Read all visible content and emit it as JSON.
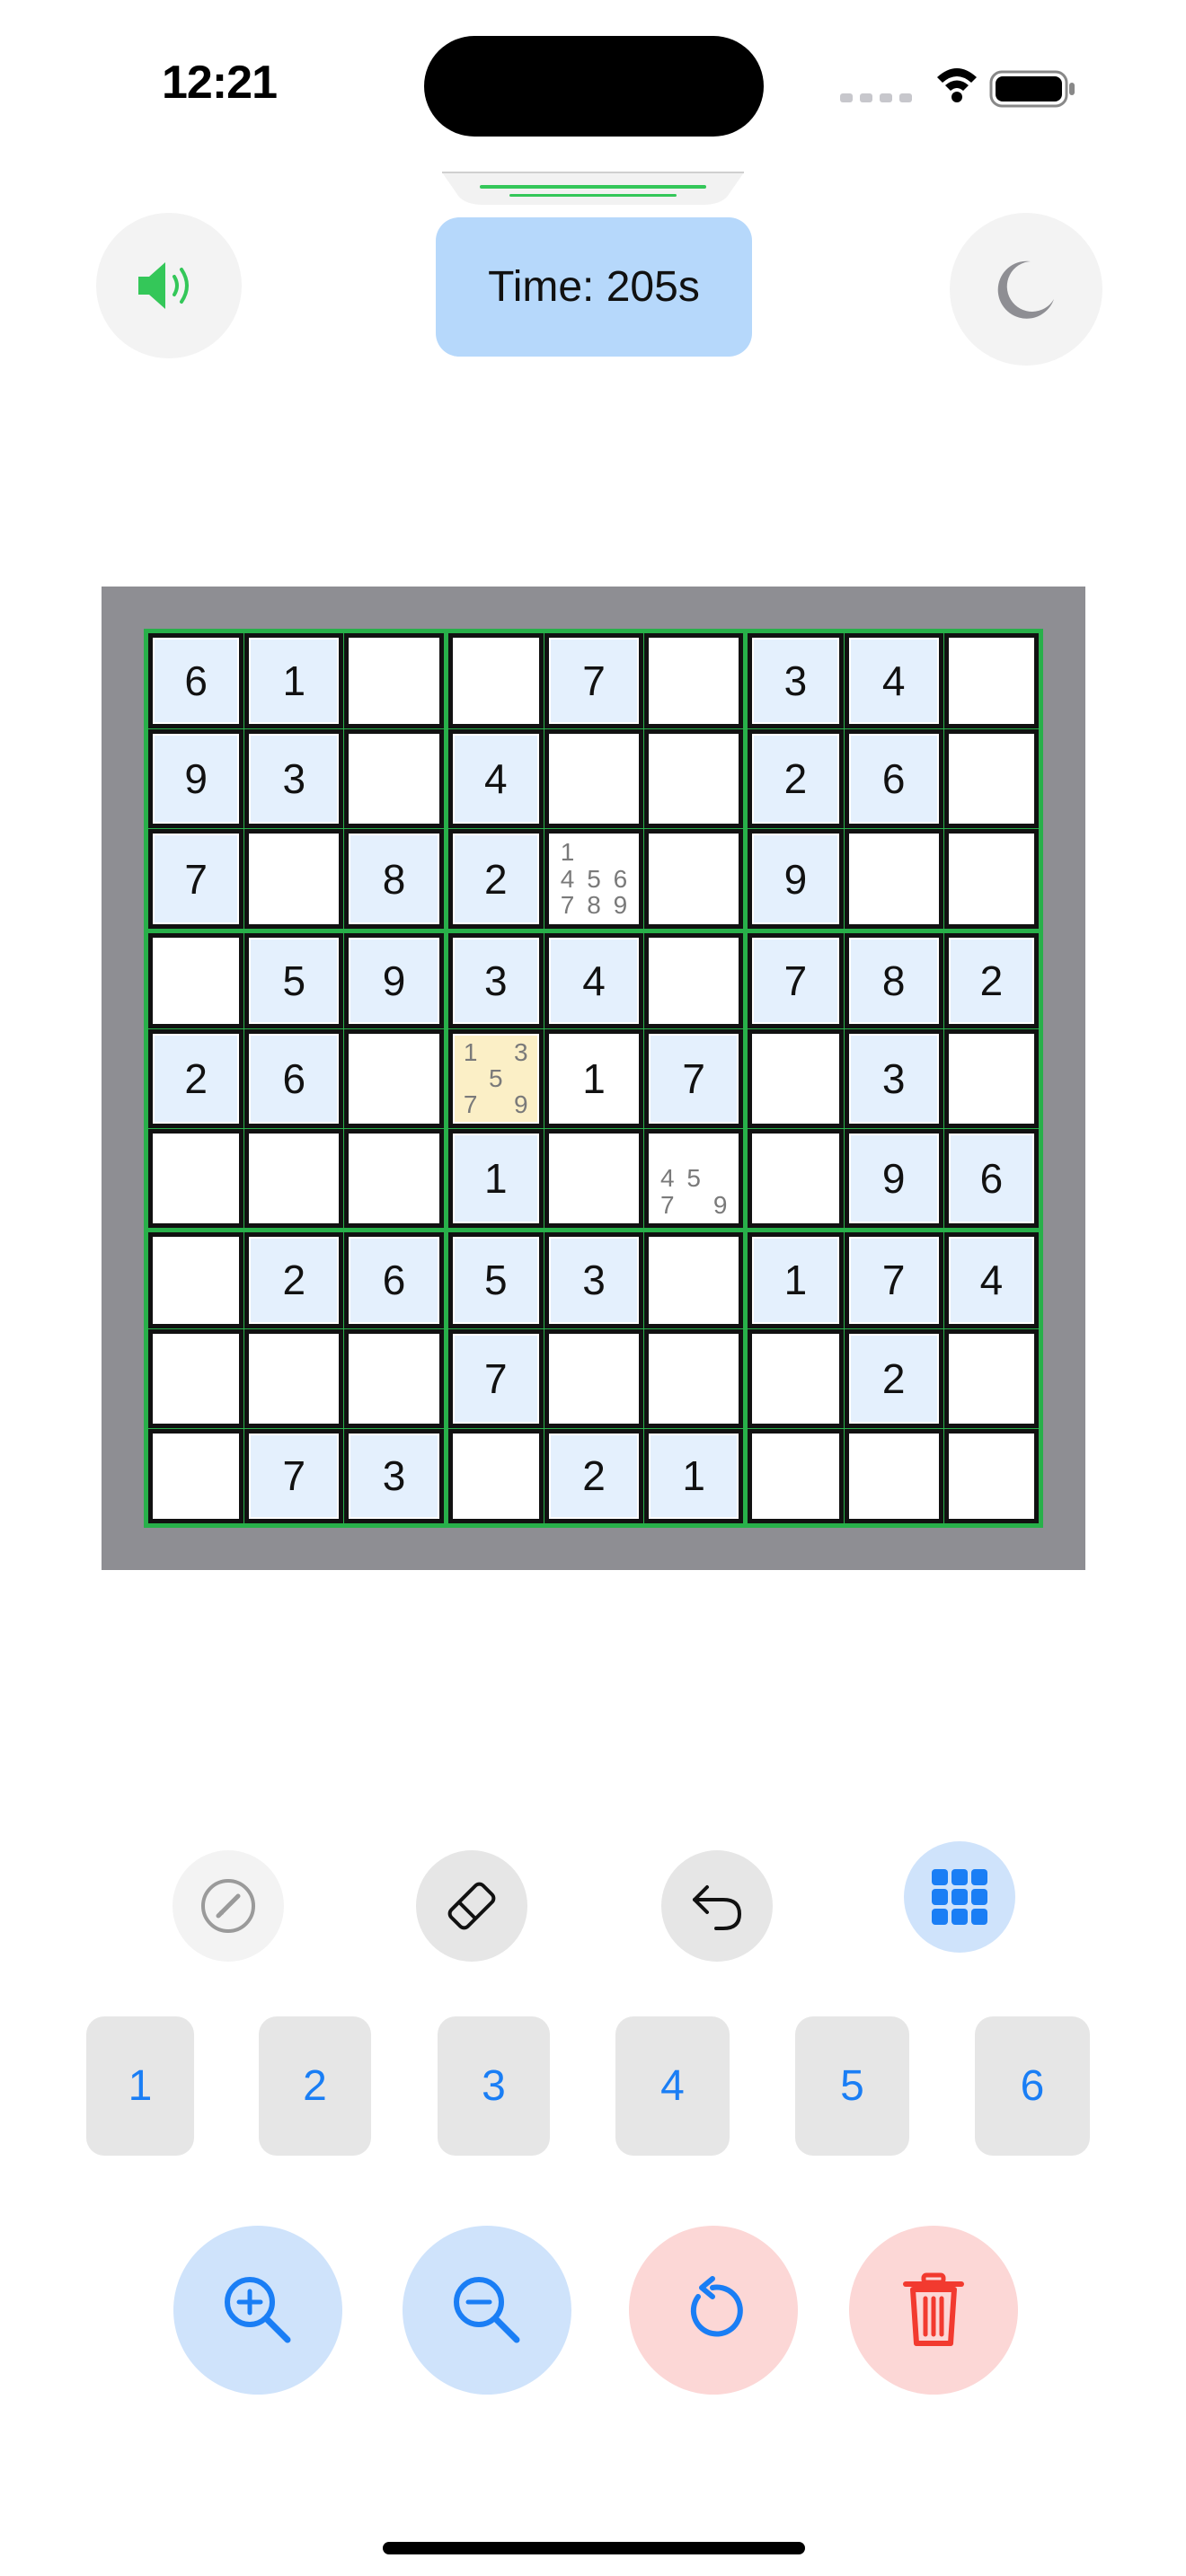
{
  "status_bar": {
    "time": "12:21"
  },
  "header": {
    "timer_text": "Time: 205s",
    "sound_icon": "speaker-wave-icon",
    "theme_icon": "moon-icon"
  },
  "board": {
    "rows": [
      [
        {
          "v": "6",
          "g": true
        },
        {
          "v": "1",
          "g": true
        },
        {
          "v": ""
        },
        {
          "v": ""
        },
        {
          "v": "7",
          "g": true
        },
        {
          "v": ""
        },
        {
          "v": "3",
          "g": true
        },
        {
          "v": "4",
          "g": true
        },
        {
          "v": ""
        }
      ],
      [
        {
          "v": "9",
          "g": true
        },
        {
          "v": "3",
          "g": true
        },
        {
          "v": ""
        },
        {
          "v": "4",
          "g": true
        },
        {
          "v": ""
        },
        {
          "v": ""
        },
        {
          "v": "2",
          "g": true
        },
        {
          "v": "6",
          "g": true
        },
        {
          "v": ""
        }
      ],
      [
        {
          "v": "7",
          "g": true
        },
        {
          "v": ""
        },
        {
          "v": "8",
          "g": true
        },
        {
          "v": "2",
          "g": true
        },
        {
          "v": "",
          "notes": [
            "1",
            "",
            "",
            "4",
            "5",
            "6",
            "7",
            "8",
            "9"
          ]
        },
        {
          "v": ""
        },
        {
          "v": "9",
          "g": true
        },
        {
          "v": ""
        },
        {
          "v": ""
        }
      ],
      [
        {
          "v": ""
        },
        {
          "v": "5",
          "g": true
        },
        {
          "v": "9",
          "g": true
        },
        {
          "v": "3",
          "g": true
        },
        {
          "v": "4",
          "g": true
        },
        {
          "v": ""
        },
        {
          "v": "7",
          "g": true
        },
        {
          "v": "8",
          "g": true
        },
        {
          "v": "2",
          "g": true
        }
      ],
      [
        {
          "v": "2",
          "g": true
        },
        {
          "v": "6",
          "g": true
        },
        {
          "v": ""
        },
        {
          "v": "",
          "notes": [
            "1",
            "",
            "3",
            "",
            "5",
            "",
            "7",
            "",
            "9"
          ],
          "selected": true
        },
        {
          "v": "1"
        },
        {
          "v": "7",
          "g": true
        },
        {
          "v": ""
        },
        {
          "v": "3",
          "g": true
        },
        {
          "v": ""
        }
      ],
      [
        {
          "v": ""
        },
        {
          "v": ""
        },
        {
          "v": ""
        },
        {
          "v": "1",
          "g": true
        },
        {
          "v": ""
        },
        {
          "v": "",
          "notes": [
            "",
            "",
            "",
            "4",
            "5",
            "",
            "7",
            "",
            "9"
          ]
        },
        {
          "v": ""
        },
        {
          "v": "9",
          "g": true
        },
        {
          "v": "6",
          "g": true
        }
      ],
      [
        {
          "v": ""
        },
        {
          "v": "2",
          "g": true
        },
        {
          "v": "6",
          "g": true
        },
        {
          "v": "5",
          "g": true
        },
        {
          "v": "3",
          "g": true
        },
        {
          "v": ""
        },
        {
          "v": "1",
          "g": true
        },
        {
          "v": "7",
          "g": true
        },
        {
          "v": "4",
          "g": true
        }
      ],
      [
        {
          "v": ""
        },
        {
          "v": ""
        },
        {
          "v": ""
        },
        {
          "v": "7",
          "g": true
        },
        {
          "v": ""
        },
        {
          "v": ""
        },
        {
          "v": ""
        },
        {
          "v": "2",
          "g": true
        },
        {
          "v": ""
        }
      ],
      [
        {
          "v": ""
        },
        {
          "v": "7",
          "g": true
        },
        {
          "v": "3",
          "g": true
        },
        {
          "v": ""
        },
        {
          "v": "2",
          "g": true
        },
        {
          "v": "1",
          "g": true
        },
        {
          "v": ""
        },
        {
          "v": ""
        },
        {
          "v": ""
        }
      ]
    ]
  },
  "tools": {
    "pencil_icon": "pencil-circle-icon",
    "eraser_icon": "eraser-icon",
    "undo_icon": "undo-arrow-icon",
    "grid_icon": "grid-icon"
  },
  "number_keys": [
    "1",
    "2",
    "3",
    "4",
    "5",
    "6"
  ],
  "actions": {
    "zoom_in_icon": "zoom-in-icon",
    "zoom_out_icon": "zoom-out-icon",
    "reset_icon": "rotate-ccw-icon",
    "delete_icon": "trash-icon"
  },
  "colors": {
    "accent": "#1a7ef5",
    "box_border": "#28b04a",
    "given_cell": "#e4f0fd",
    "selected_cell": "#fbefc6",
    "danger": "#f23a2f"
  }
}
